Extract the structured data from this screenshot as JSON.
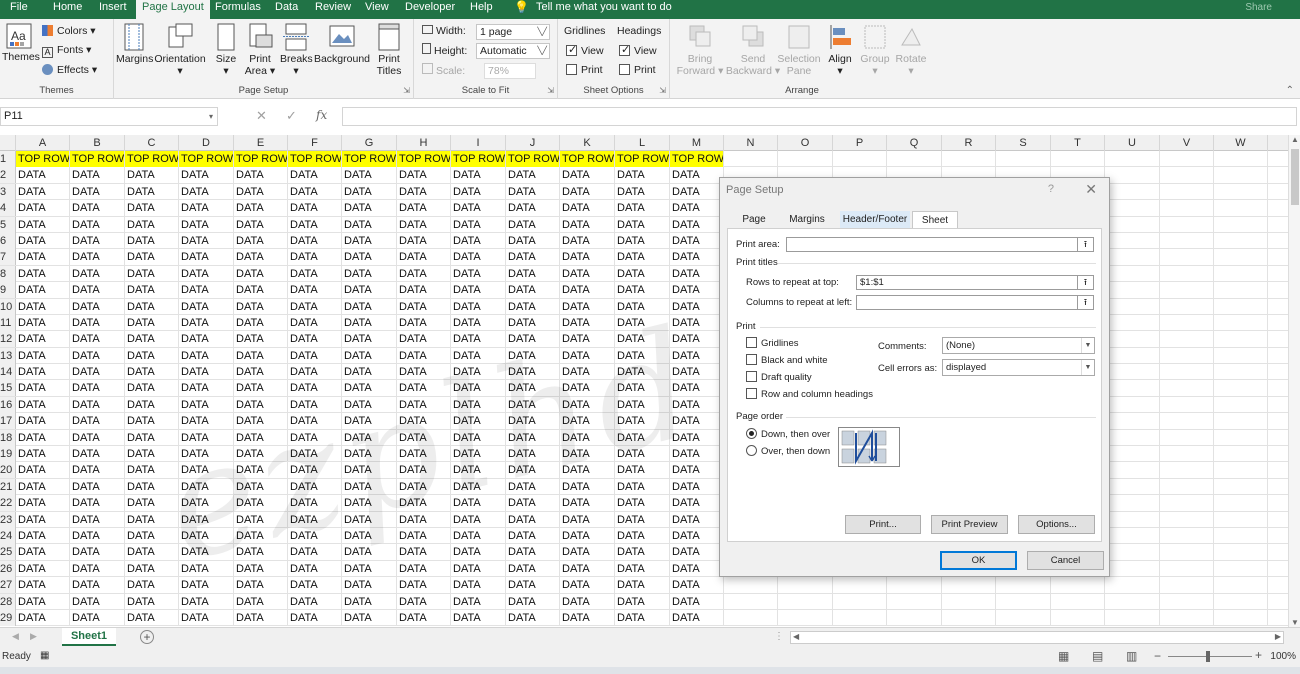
{
  "ribbon_tabs": [
    "File",
    "Home",
    "Insert",
    "Page Layout",
    "Formulas",
    "Data",
    "Review",
    "View",
    "Developer",
    "Help"
  ],
  "tell_me": "Tell me what you want to do",
  "share": "Share",
  "themes": {
    "themes_label": "Themes",
    "colors_label": "Colors",
    "fonts_label": "Fonts",
    "effects_label": "Effects",
    "group_label": "Themes"
  },
  "page_setup_group": {
    "margins": "Margins",
    "orientation": "Orientation",
    "size": "Size",
    "print_area_1": "Print",
    "print_area_2": "Area",
    "breaks": "Breaks",
    "background": "Background",
    "print_titles_1": "Print",
    "print_titles_2": "Titles",
    "group_label": "Page Setup"
  },
  "scale_to_fit": {
    "width_label": "Width:",
    "width_value": "1 page",
    "height_label": "Height:",
    "height_value": "Automatic",
    "scale_label": "Scale:",
    "scale_value": "78%",
    "group_label": "Scale to Fit"
  },
  "sheet_options": {
    "gridlines": "Gridlines",
    "headings": "Headings",
    "view": "View",
    "print": "Print",
    "group_label": "Sheet Options"
  },
  "arrange": {
    "bring_forward_1": "Bring",
    "bring_forward_2": "Forward",
    "send_backward_1": "Send",
    "send_backward_2": "Backward",
    "selection_pane_1": "Selection",
    "selection_pane_2": "Pane",
    "align": "Align",
    "group": "Group",
    "rotate": "Rotate",
    "group_label": "Arrange"
  },
  "name_box": "P11",
  "fx": "fx",
  "columns": [
    "A",
    "B",
    "C",
    "D",
    "E",
    "F",
    "G",
    "H",
    "I",
    "J",
    "K",
    "L",
    "M",
    "N",
    "O",
    "P",
    "Q",
    "R",
    "S",
    "T",
    "U",
    "V",
    "W"
  ],
  "row_numbers": [
    "1",
    "2",
    "3",
    "4",
    "5",
    "6",
    "7",
    "8",
    "9",
    "10",
    "11",
    "12",
    "13",
    "14",
    "15",
    "16",
    "17",
    "18",
    "19",
    "20",
    "21",
    "22",
    "23",
    "24",
    "25",
    "26",
    "27",
    "28",
    "29"
  ],
  "top_row_text": "TOP ROW",
  "data_text": "DATA",
  "watermark": "ezplhd.net",
  "sheet_tab": "Sheet1",
  "status": "Ready",
  "zoom": "100%",
  "dialog": {
    "title": "Page Setup",
    "help": "?",
    "close": "✕",
    "tabs": [
      "Page",
      "Margins",
      "Header/Footer",
      "Sheet"
    ],
    "print_area_label": "Print area:",
    "print_titles_label": "Print titles",
    "rows_repeat_label": "Rows to repeat at top:",
    "rows_repeat_value": "$1:$1",
    "cols_repeat_label": "Columns to repeat at left:",
    "cols_repeat_value": "",
    "print_section": "Print",
    "gridlines": "Gridlines",
    "black_white": "Black and white",
    "draft_quality": "Draft quality",
    "row_col_headings": "Row and column headings",
    "comments_label": "Comments:",
    "comments_value": "(None)",
    "cell_errors_label": "Cell errors as:",
    "cell_errors_value": "displayed",
    "page_order_label": "Page order",
    "down_then_over": "Down, then over",
    "over_then_down": "Over, then down",
    "print_btn": "Print...",
    "print_preview_btn": "Print Preview",
    "options_btn": "Options...",
    "ok_btn": "OK",
    "cancel_btn": "Cancel"
  }
}
